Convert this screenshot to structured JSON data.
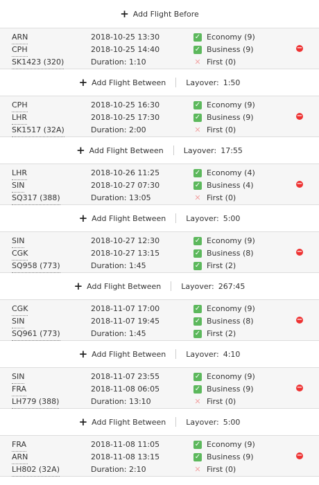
{
  "add_before_label": "Add Flight Before",
  "add_between_label": "Add Flight Between",
  "layover_prefix": "Layover:",
  "segments": [
    {
      "from": "ARN",
      "to": "CPH",
      "flight": "SK1423 (320)",
      "dep": "2018-10-25 13:30",
      "arr": "2018-10-25 14:40",
      "duration": "Duration: 1:10",
      "classes": [
        {
          "label": "Economy (9)",
          "ok": true
        },
        {
          "label": "Business (9)",
          "ok": true
        },
        {
          "label": "First (0)",
          "ok": false
        }
      ]
    },
    {
      "from": "CPH",
      "to": "LHR",
      "flight": "SK1517 (32A)",
      "dep": "2018-10-25 16:30",
      "arr": "2018-10-25 17:30",
      "duration": "Duration: 2:00",
      "classes": [
        {
          "label": "Economy (9)",
          "ok": true
        },
        {
          "label": "Business (9)",
          "ok": true
        },
        {
          "label": "First (0)",
          "ok": false
        }
      ]
    },
    {
      "from": "LHR",
      "to": "SIN",
      "flight": "SQ317 (388)",
      "dep": "2018-10-26 11:25",
      "arr": "2018-10-27 07:30",
      "duration": "Duration: 13:05",
      "classes": [
        {
          "label": "Economy (4)",
          "ok": true
        },
        {
          "label": "Business (4)",
          "ok": true
        },
        {
          "label": "First (0)",
          "ok": false
        }
      ]
    },
    {
      "from": "SIN",
      "to": "CGK",
      "flight": "SQ958 (773)",
      "dep": "2018-10-27 12:30",
      "arr": "2018-10-27 13:15",
      "duration": "Duration: 1:45",
      "classes": [
        {
          "label": "Economy (9)",
          "ok": true
        },
        {
          "label": "Business (8)",
          "ok": true
        },
        {
          "label": "First (2)",
          "ok": true
        }
      ]
    },
    {
      "from": "CGK",
      "to": "SIN",
      "flight": "SQ961 (773)",
      "dep": "2018-11-07 17:00",
      "arr": "2018-11-07 19:45",
      "duration": "Duration: 1:45",
      "classes": [
        {
          "label": "Economy (9)",
          "ok": true
        },
        {
          "label": "Business (8)",
          "ok": true
        },
        {
          "label": "First (2)",
          "ok": true
        }
      ]
    },
    {
      "from": "SIN",
      "to": "FRA",
      "flight": "LH779 (388)",
      "dep": "2018-11-07 23:55",
      "arr": "2018-11-08 06:05",
      "duration": "Duration: 13:10",
      "classes": [
        {
          "label": "Economy (9)",
          "ok": true
        },
        {
          "label": "Business (9)",
          "ok": true
        },
        {
          "label": "First (0)",
          "ok": false
        }
      ]
    },
    {
      "from": "FRA",
      "to": "ARN",
      "flight": "LH802 (32A)",
      "dep": "2018-11-08 11:05",
      "arr": "2018-11-08 13:15",
      "duration": "Duration: 2:10",
      "classes": [
        {
          "label": "Economy (9)",
          "ok": true
        },
        {
          "label": "Business (9)",
          "ok": true
        },
        {
          "label": "First (0)",
          "ok": false
        }
      ]
    }
  ],
  "layovers": [
    "1:50",
    "17:55",
    "5:00",
    "267:45",
    "4:10",
    "5:00"
  ]
}
